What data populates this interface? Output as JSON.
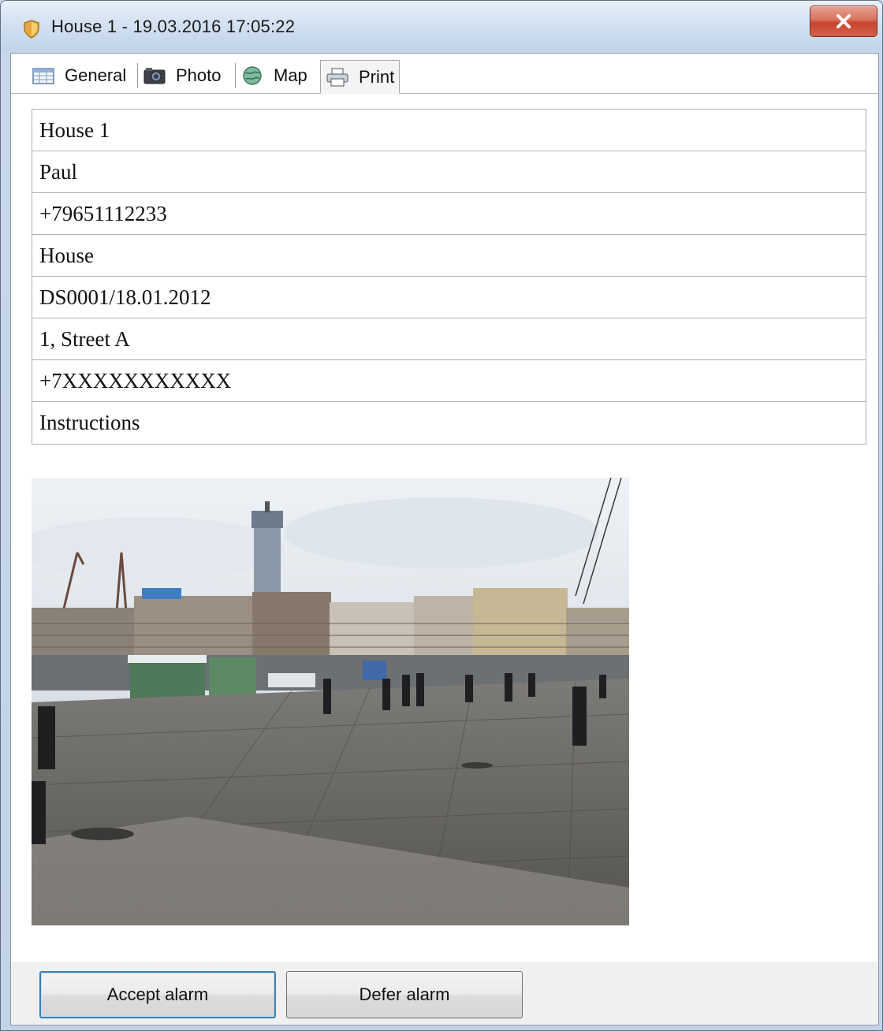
{
  "window": {
    "title": "House 1 - 19.03.2016 17:05:22",
    "icon": "shield-icon",
    "close_icon": "close-icon"
  },
  "tabs": [
    {
      "label": "General",
      "icon": "table-icon"
    },
    {
      "label": "Photo",
      "icon": "camera-icon"
    },
    {
      "label": "Map",
      "icon": "globe-icon"
    },
    {
      "label": "Print",
      "icon": "printer-icon",
      "active": true
    }
  ],
  "info_rows": [
    "House 1",
    "Paul",
    "+79651112233",
    "House",
    "DS0001/18.01.2012",
    "1, Street A",
    "+7XXXXXXXXXXX",
    "Instructions"
  ],
  "photo": {
    "subject": "street-scene-photo"
  },
  "buttons": {
    "accept": "Accept alarm",
    "defer": "Defer alarm"
  },
  "colors": {
    "close_button": "#c5442e",
    "default_button_border": "#3c7fb1"
  }
}
